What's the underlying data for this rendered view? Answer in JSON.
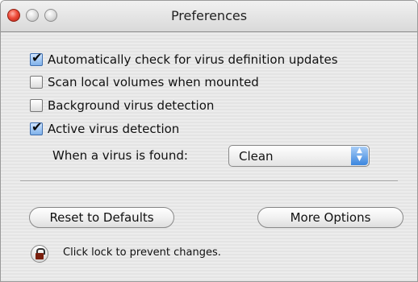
{
  "window": {
    "title": "Preferences"
  },
  "options": [
    {
      "label": "Automatically check for virus definition updates",
      "checked": true
    },
    {
      "label": "Scan local volumes when mounted",
      "checked": false
    },
    {
      "label": "Background virus detection",
      "checked": false
    },
    {
      "label": "Active virus detection",
      "checked": true
    }
  ],
  "virus_found": {
    "label": "When a virus is found:",
    "selected": "Clean"
  },
  "buttons": {
    "reset": "Reset to Defaults",
    "more": "More Options"
  },
  "lock": {
    "text": "Click lock to prevent changes.",
    "icon": "lock-icon"
  },
  "colors": {
    "close_button": "#ee4b3a",
    "popup_arrows": "#3c86de"
  }
}
